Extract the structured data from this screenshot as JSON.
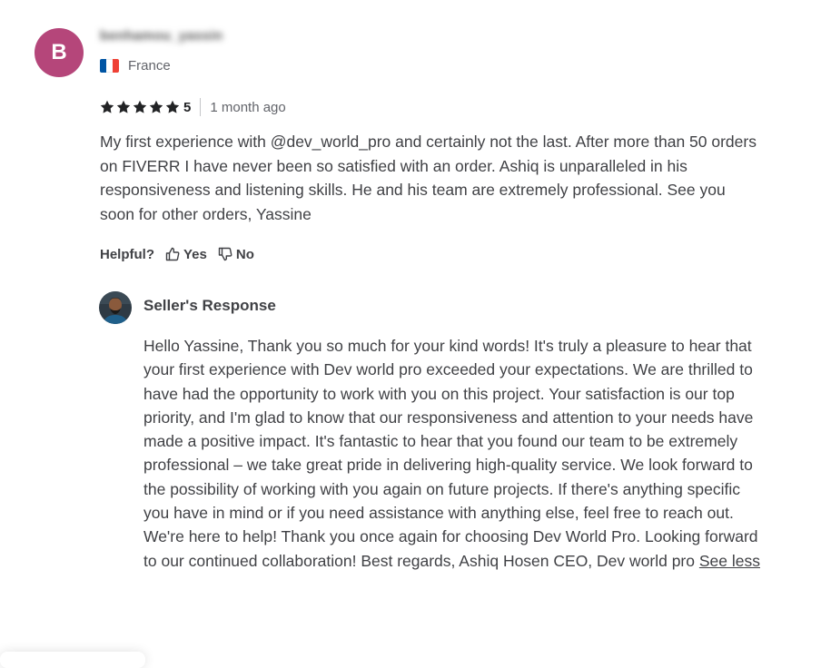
{
  "reviewer": {
    "initial": "B",
    "username": "benhamou_yassin",
    "country": "France",
    "avatar_color": "#b5467a"
  },
  "rating": {
    "value": "5",
    "stars": 5,
    "time_ago": "1 month ago",
    "star_color": "#222325"
  },
  "review": {
    "text": "My first experience with @dev_world_pro and certainly not the last. After more than 50 orders on FIVERR I have never been so satisfied with an order. Ashiq is unparalleled in his responsiveness and listening skills. He and his team are extremely professional. See you soon for other orders, Yassine"
  },
  "helpful": {
    "label": "Helpful?",
    "yes_label": "Yes",
    "no_label": "No"
  },
  "seller_response": {
    "title": "Seller's Response",
    "text": "Hello Yassine, Thank you so much for your kind words! It's truly a pleasure to hear that your first experience with Dev world pro exceeded your expectations. We are thrilled to have had the opportunity to work with you on this project. Your satisfaction is our top priority, and I'm glad to know that our responsiveness and attention to your needs have made a positive impact. It's fantastic to hear that you found our team to be extremely professional – we take great pride in delivering high-quality service. We look forward to the possibility of working with you again on future projects. If there's anything specific you have in mind or if you need assistance with anything else, feel free to reach out. We're here to help! Thank you once again for choosing Dev World Pro. Looking forward to our continued collaboration! Best regards, Ashiq Hosen CEO, Dev world pro",
    "see_less_label": "See less"
  }
}
